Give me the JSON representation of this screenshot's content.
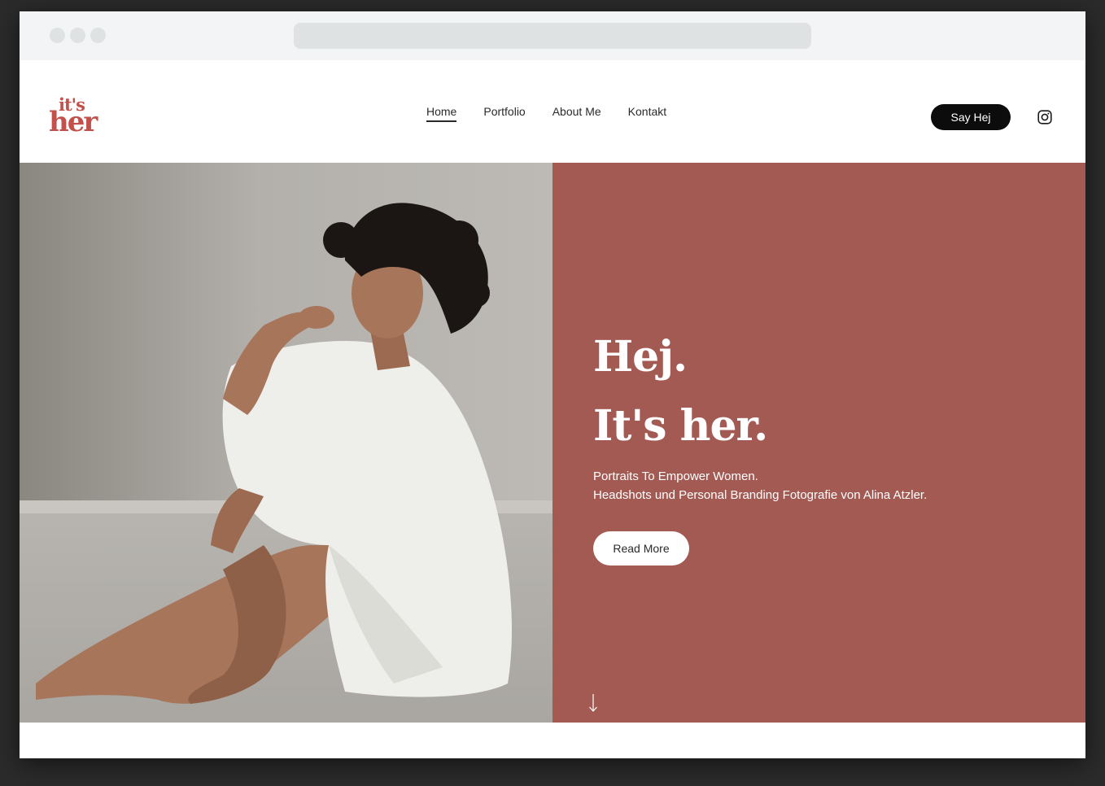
{
  "brand": {
    "logo_top": "it's",
    "logo_bottom": "her",
    "logo_color": "#c2514b"
  },
  "nav": {
    "items": [
      {
        "label": "Home",
        "active": true
      },
      {
        "label": "Portfolio",
        "active": false
      },
      {
        "label": "About Me",
        "active": false
      },
      {
        "label": "Kontakt",
        "active": false
      }
    ]
  },
  "header": {
    "cta_label": "Say Hej",
    "social_icon": "instagram-icon"
  },
  "hero": {
    "heading_line1": "Hej.",
    "heading_line2": "It's her.",
    "subtitle_line1": "Portraits To Empower Women.",
    "subtitle_line2": "Headshots und Personal Branding Fotografie von Alina Atzler.",
    "button_label": "Read More",
    "panel_color": "#a35a53",
    "scroll_icon": "arrow-down-icon"
  },
  "colors": {
    "accent": "#a35a53",
    "cta_bg": "#0c0c0c",
    "text_dark": "#2a2a2a"
  }
}
